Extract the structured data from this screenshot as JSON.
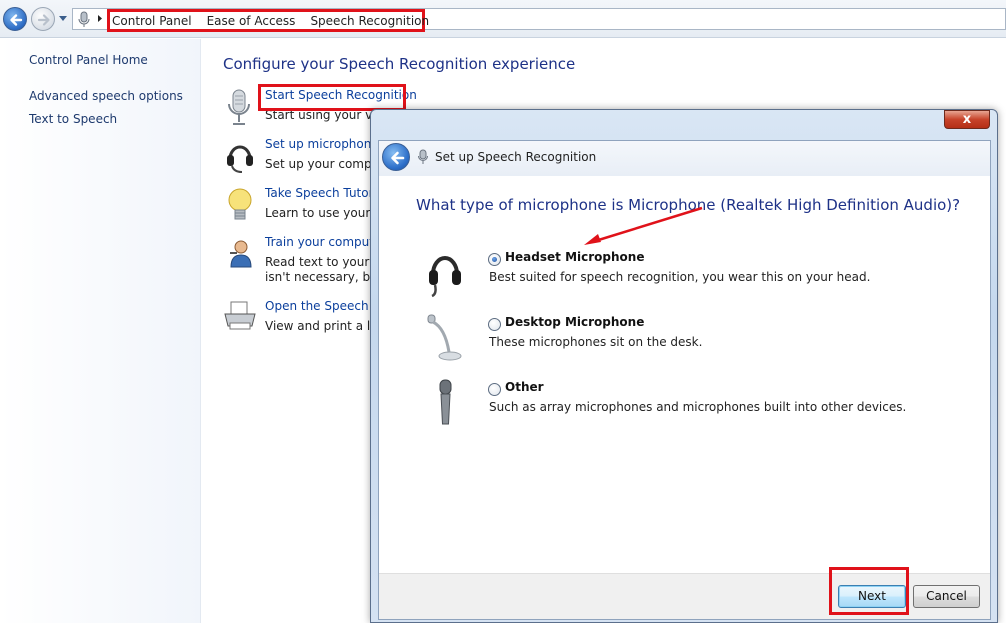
{
  "address_bar": {
    "crumbs": [
      "Control Panel",
      "Ease of Access",
      "Speech Recognition"
    ]
  },
  "left_pane": {
    "items": [
      {
        "label": "Control Panel Home"
      },
      {
        "label": "Advanced speech options"
      },
      {
        "label": "Text to Speech"
      }
    ]
  },
  "main": {
    "title": "Configure your Speech Recognition experience",
    "tasks": [
      {
        "icon": "microphone-icon",
        "link": "Start Speech Recognition",
        "desc": [
          "Start using your voi"
        ]
      },
      {
        "icon": "headset-icon",
        "link": "Set up microphone",
        "desc": [
          "Set up your comput"
        ]
      },
      {
        "icon": "lightbulb-icon",
        "link": "Take Speech Tutoria",
        "desc": [
          "Learn to use your co"
        ]
      },
      {
        "icon": "person-icon",
        "link": "Train your compute",
        "desc": [
          "Read text to your co",
          "isn't necessary, but"
        ]
      },
      {
        "icon": "printer-icon",
        "link": "Open the Speech Re",
        "desc": [
          "View and print a list"
        ]
      }
    ]
  },
  "dialog": {
    "title": "Set up Speech Recognition",
    "close_label": "x",
    "question": "What type of microphone is Microphone (Realtek High Definition Audio)?",
    "options": [
      {
        "label": "Headset Microphone",
        "desc": "Best suited for speech recognition, you wear this on your head.",
        "selected": true,
        "icon": "headset-microphone-icon"
      },
      {
        "label": "Desktop Microphone",
        "desc": "These microphones sit on the desk.",
        "selected": false,
        "icon": "desktop-microphone-icon"
      },
      {
        "label": "Other",
        "desc": "Such as array microphones and microphones built into other devices.",
        "selected": false,
        "icon": "handheld-microphone-icon"
      }
    ],
    "next_label": "Next",
    "cancel_label": "Cancel"
  },
  "colors": {
    "highlight_red": "#e0121a",
    "link_blue": "#0b3f9c",
    "heading_blue": "#1e3287"
  }
}
